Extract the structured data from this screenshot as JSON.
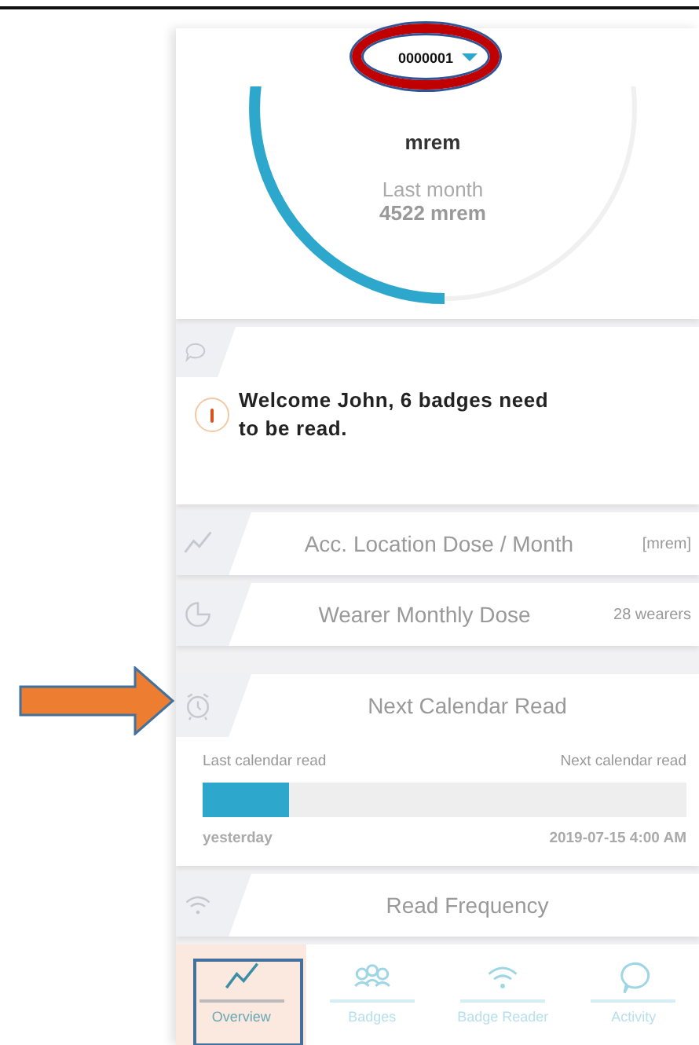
{
  "device_selector": {
    "value": "0000001"
  },
  "dose_gauge": {
    "level": 0.5,
    "unit": "mrem",
    "previous_label": "Last month",
    "previous_value": "4522 mrem"
  },
  "message": {
    "text": "Welcome John, 6 badges need to be read."
  },
  "sections": [
    {
      "kind": "trend",
      "title": "Acc. Location Dose / Month",
      "note": "[mrem]"
    },
    {
      "kind": "pie",
      "title": "Wearer Monthly Dose",
      "note": "28 wearers"
    },
    {
      "kind": "alarm",
      "title": "Next Calendar Read",
      "progress": {
        "start_label": "Last calendar read",
        "end_label": "Next calendar read",
        "level": 0.18,
        "start_value": "yesterday",
        "end_value": "2019-07-15 4:00 AM"
      }
    },
    {
      "kind": "wifi",
      "title": "Read Frequency"
    }
  ],
  "tabs": [
    {
      "kind": "trend",
      "label": "Overview",
      "selected": true
    },
    {
      "kind": "people",
      "label": "Badges",
      "selected": false
    },
    {
      "kind": "wifi",
      "label": "Badge Reader",
      "selected": false
    },
    {
      "kind": "bubble",
      "label": "Activity",
      "selected": false
    }
  ],
  "annotations": [
    {
      "kind": "ellipse"
    },
    {
      "kind": "arrow"
    },
    {
      "kind": "box"
    }
  ]
}
